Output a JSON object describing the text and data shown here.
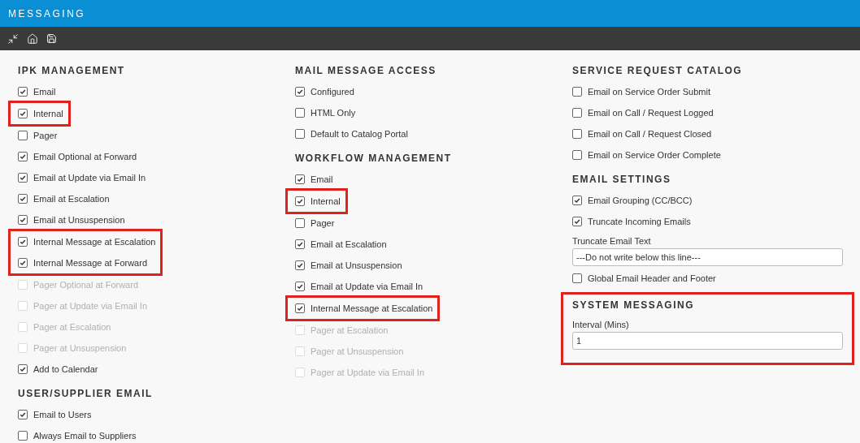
{
  "window": {
    "title": "MESSAGING"
  },
  "toolbar": [
    {
      "kind": "collapse"
    },
    {
      "kind": "home"
    },
    {
      "kind": "save"
    }
  ],
  "columns": [
    {
      "sections": [
        {
          "title": "IPK MANAGEMENT",
          "highlighted": false,
          "items": [
            {
              "kind": "checkbox",
              "label": "Email",
              "checked": true,
              "disabled": false,
              "highlighted": false
            },
            {
              "kind": "checkbox",
              "label": "Internal",
              "checked": true,
              "disabled": false,
              "highlighted": true
            },
            {
              "kind": "checkbox",
              "label": "Pager",
              "checked": false,
              "disabled": false,
              "highlighted": false
            },
            {
              "kind": "checkbox",
              "label": "Email Optional at Forward",
              "checked": true,
              "disabled": false,
              "highlighted": false
            },
            {
              "kind": "checkbox",
              "label": "Email at Update via Email In",
              "checked": true,
              "disabled": false,
              "highlighted": false
            },
            {
              "kind": "checkbox",
              "label": "Email at Escalation",
              "checked": true,
              "disabled": false,
              "highlighted": false
            },
            {
              "kind": "checkbox",
              "label": "Email at Unsuspension",
              "checked": true,
              "disabled": false,
              "highlighted": false
            },
            {
              "kind": "checkbox",
              "label": "Internal Message at Escalation",
              "checked": true,
              "disabled": false,
              "highlighted": true
            },
            {
              "kind": "checkbox",
              "label": "Internal Message at Forward",
              "checked": true,
              "disabled": false,
              "highlighted": true
            },
            {
              "kind": "checkbox",
              "label": "Pager Optional at Forward",
              "checked": false,
              "disabled": true,
              "highlighted": false
            },
            {
              "kind": "checkbox",
              "label": "Pager at Update via Email In",
              "checked": false,
              "disabled": true,
              "highlighted": false
            },
            {
              "kind": "checkbox",
              "label": "Pager at Escalation",
              "checked": false,
              "disabled": true,
              "highlighted": false
            },
            {
              "kind": "checkbox",
              "label": "Pager at Unsuspension",
              "checked": false,
              "disabled": true,
              "highlighted": false
            },
            {
              "kind": "checkbox",
              "label": "Add to Calendar",
              "checked": true,
              "disabled": false,
              "highlighted": false
            }
          ]
        },
        {
          "title": "USER/SUPPLIER EMAIL",
          "highlighted": false,
          "items": [
            {
              "kind": "checkbox",
              "label": "Email to Users",
              "checked": true,
              "disabled": false,
              "highlighted": false
            },
            {
              "kind": "checkbox",
              "label": "Always Email to Suppliers",
              "checked": false,
              "disabled": false,
              "highlighted": false
            }
          ]
        }
      ]
    },
    {
      "sections": [
        {
          "title": "MAIL MESSAGE ACCESS",
          "highlighted": false,
          "items": [
            {
              "kind": "checkbox",
              "label": "Configured",
              "checked": true,
              "disabled": false,
              "highlighted": false
            },
            {
              "kind": "checkbox",
              "label": "HTML Only",
              "checked": false,
              "disabled": false,
              "highlighted": false
            },
            {
              "kind": "checkbox",
              "label": "Default to Catalog Portal",
              "checked": false,
              "disabled": false,
              "highlighted": false
            }
          ]
        },
        {
          "title": "WORKFLOW MANAGEMENT",
          "highlighted": false,
          "items": [
            {
              "kind": "checkbox",
              "label": "Email",
              "checked": true,
              "disabled": false,
              "highlighted": false
            },
            {
              "kind": "checkbox",
              "label": "Internal",
              "checked": true,
              "disabled": false,
              "highlighted": true
            },
            {
              "kind": "checkbox",
              "label": "Pager",
              "checked": false,
              "disabled": false,
              "highlighted": false
            },
            {
              "kind": "checkbox",
              "label": "Email at Escalation",
              "checked": true,
              "disabled": false,
              "highlighted": false
            },
            {
              "kind": "checkbox",
              "label": "Email at Unsuspension",
              "checked": true,
              "disabled": false,
              "highlighted": false
            },
            {
              "kind": "checkbox",
              "label": "Email at Update via Email In",
              "checked": true,
              "disabled": false,
              "highlighted": false
            },
            {
              "kind": "checkbox",
              "label": "Internal Message at Escalation",
              "checked": true,
              "disabled": false,
              "highlighted": true
            },
            {
              "kind": "checkbox",
              "label": "Pager at Escalation",
              "checked": false,
              "disabled": true,
              "highlighted": false
            },
            {
              "kind": "checkbox",
              "label": "Pager at Unsuspension",
              "checked": false,
              "disabled": true,
              "highlighted": false
            },
            {
              "kind": "checkbox",
              "label": "Pager at Update via Email In",
              "checked": false,
              "disabled": true,
              "highlighted": false
            }
          ]
        }
      ]
    },
    {
      "sections": [
        {
          "title": "SERVICE REQUEST CATALOG",
          "highlighted": false,
          "items": [
            {
              "kind": "checkbox",
              "label": "Email on Service Order Submit",
              "checked": false,
              "disabled": false,
              "highlighted": false
            },
            {
              "kind": "checkbox",
              "label": "Email on Call / Request Logged",
              "checked": false,
              "disabled": false,
              "highlighted": false
            },
            {
              "kind": "checkbox",
              "label": "Email on Call / Request Closed",
              "checked": false,
              "disabled": false,
              "highlighted": false
            },
            {
              "kind": "checkbox",
              "label": "Email on Service Order Complete",
              "checked": false,
              "disabled": false,
              "highlighted": false
            }
          ]
        },
        {
          "title": "EMAIL SETTINGS",
          "highlighted": false,
          "items": [
            {
              "kind": "checkbox",
              "label": "Email Grouping (CC/BCC)",
              "checked": true,
              "disabled": false,
              "highlighted": false
            },
            {
              "kind": "checkbox",
              "label": "Truncate Incoming Emails",
              "checked": true,
              "disabled": false,
              "highlighted": false
            },
            {
              "kind": "field",
              "label": "Truncate Email Text",
              "value": "---Do not write below this line---",
              "highlighted": false
            },
            {
              "kind": "checkbox",
              "label": "Global Email Header and Footer",
              "checked": false,
              "disabled": false,
              "highlighted": false
            }
          ]
        },
        {
          "title": "SYSTEM MESSAGING",
          "highlighted": true,
          "items": [
            {
              "kind": "field",
              "label": "Interval (Mins)",
              "value": "1",
              "highlighted": false
            }
          ]
        }
      ]
    }
  ]
}
